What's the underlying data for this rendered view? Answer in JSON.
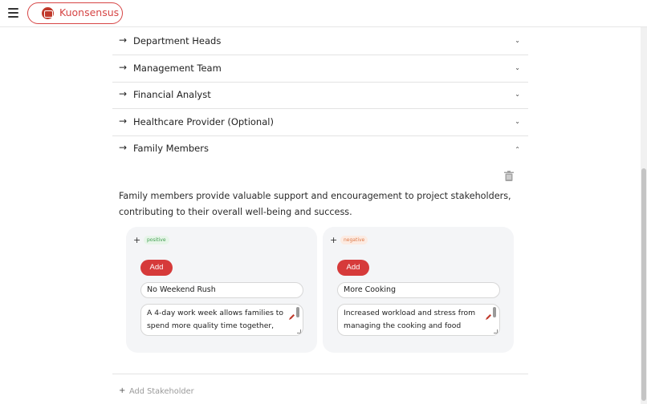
{
  "header": {
    "brand_name": "Kuonsensus",
    "brand_color": "#d64545"
  },
  "accordion": {
    "arrow": "→",
    "chevron_down": "⌄",
    "chevron_up": "⌃",
    "items": [
      {
        "label": "Department Heads",
        "expanded": false
      },
      {
        "label": "Management Team",
        "expanded": false
      },
      {
        "label": "Financial Analyst",
        "expanded": false
      },
      {
        "label": "Healthcare Provider (Optional)",
        "expanded": false
      },
      {
        "label": "Family Members",
        "expanded": true
      }
    ]
  },
  "expanded_section": {
    "description": "Family members provide valuable support and encouragement to project stakeholders, contributing to their overall well-being and success.",
    "panels": [
      {
        "plus": "+",
        "badge": "positive",
        "add_label": "Add",
        "input_value": "No Weekend Rush",
        "textarea_value": "A 4-day work week allows families to spend more quality time together,"
      },
      {
        "plus": "+",
        "badge": "negative",
        "add_label": "Add",
        "input_value": "More Cooking",
        "textarea_value": "Increased workload and stress from managing the cooking and food"
      }
    ]
  },
  "footer": {
    "plus": "+",
    "add_stakeholder_label": "Add Stakeholder"
  },
  "colors": {
    "accent": "#d63a3a",
    "positive": "#3f9d4e",
    "negative": "#de7a4a"
  }
}
